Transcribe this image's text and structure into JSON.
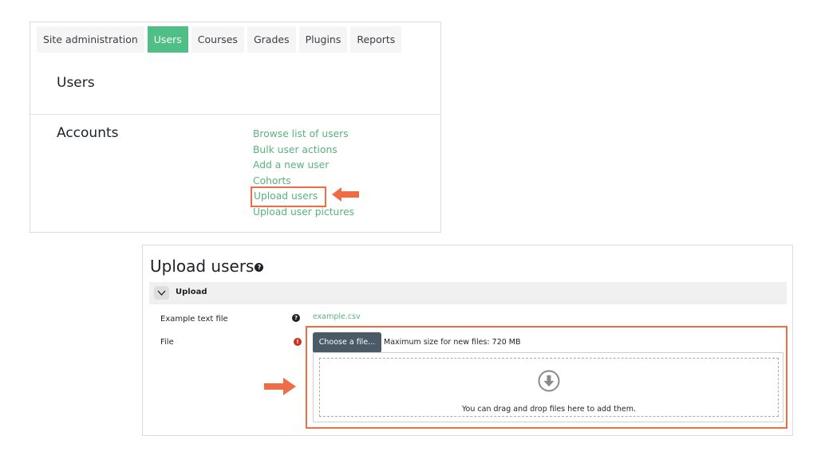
{
  "panel1": {
    "tabs": [
      {
        "label": "Site administration",
        "active": false
      },
      {
        "label": "Users",
        "active": true
      },
      {
        "label": "Courses",
        "active": false
      },
      {
        "label": "Grades",
        "active": false
      },
      {
        "label": "Plugins",
        "active": false
      },
      {
        "label": "Reports",
        "active": false
      }
    ],
    "users_heading": "Users",
    "accounts_heading": "Accounts",
    "links": [
      "Browse list of users",
      "Bulk user actions",
      "Add a new user",
      "Cohorts",
      "Upload users",
      "Upload user pictures"
    ],
    "highlighted_link": "Upload users"
  },
  "panel2": {
    "title": "Upload users",
    "title_help_icon": "question-circle-icon",
    "section": {
      "label": "Upload",
      "toggle_icon": "chevron-down-icon"
    },
    "example_row": {
      "label": "Example text file",
      "icon": "question-circle-icon",
      "link": "example.csv"
    },
    "file_row": {
      "label": "File",
      "icon": "required-exclamation-icon",
      "button_label": "Choose a file...",
      "max_size_text": "Maximum size for new files: 720 MB",
      "drop_icon": "download-arrow-icon",
      "drop_text": "You can drag and drop files here to add them."
    }
  },
  "colors": {
    "accent_green": "#4fbf86",
    "link_green": "#58b27f",
    "highlight_orange": "#ef6c44",
    "button_slate": "#4a5a66",
    "required_red": "#ca3120"
  }
}
